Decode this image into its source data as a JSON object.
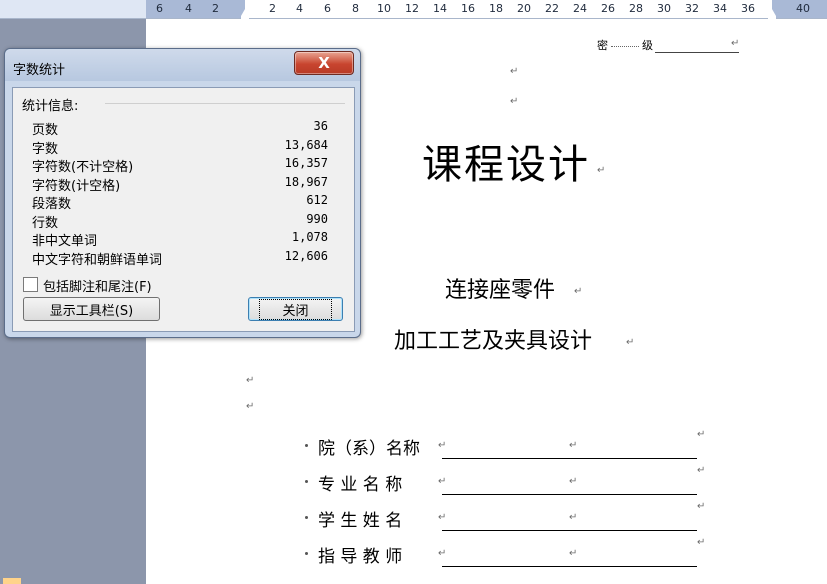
{
  "ruler": {
    "ticks": [
      "6",
      "4",
      "2",
      "2",
      "4",
      "6",
      "8",
      "10",
      "12",
      "14",
      "16",
      "18",
      "20",
      "22",
      "24",
      "26",
      "28",
      "30",
      "32",
      "34",
      "36",
      "40"
    ]
  },
  "document": {
    "header_secret": "密",
    "header_grade": "级",
    "title": "课程设计",
    "subtitle1": "连接座零件",
    "subtitle2": "加工工艺及夹具设计",
    "fields": [
      {
        "label": "院（系）名称"
      },
      {
        "label": "专 业 名 称"
      },
      {
        "label": "学 生 姓 名"
      },
      {
        "label": "指 导 教 师"
      }
    ],
    "paragraph_mark": "↵"
  },
  "dialog": {
    "title": "字数统计",
    "section": "统计信息:",
    "stats": [
      {
        "label": "页数",
        "value": "36"
      },
      {
        "label": "字数",
        "value": "13,684"
      },
      {
        "label": "字符数(不计空格)",
        "value": "16,357"
      },
      {
        "label": "字符数(计空格)",
        "value": "18,967"
      },
      {
        "label": "段落数",
        "value": "612"
      },
      {
        "label": "行数",
        "value": "990"
      },
      {
        "label": "非中文单词",
        "value": "1,078"
      },
      {
        "label": "中文字符和朝鲜语单词",
        "value": "12,606"
      }
    ],
    "checkbox_label": "包括脚注和尾注(F)",
    "toolbar_button": "显示工具栏(S)",
    "close_button": "关闭",
    "close_x": "X"
  }
}
